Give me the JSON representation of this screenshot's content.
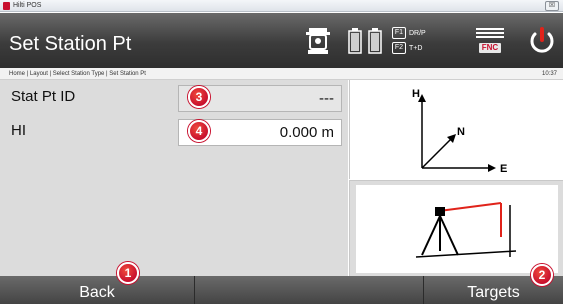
{
  "window": {
    "title": "Hilti POS",
    "close_label": "☒"
  },
  "header": {
    "title": "Set Station Pt",
    "icons": [
      "instrument-icon",
      "battery-icon",
      "fnc-icon",
      "power-icon"
    ],
    "func_keys": [
      {
        "key": "F1",
        "label": "DR/P"
      },
      {
        "key": "F2",
        "label": "T+D"
      }
    ],
    "fnc_label": "FNC"
  },
  "breadcrumb": "Home | Layout | Select Station Type | Set Station Pt",
  "clock": "10:37",
  "fields": {
    "stat_pt_id": {
      "label": "Stat Pt ID",
      "value": "---"
    },
    "hi": {
      "label": "HI",
      "value": "0.000 m"
    }
  },
  "diagram": {
    "axis_h": "H",
    "axis_n": "N",
    "axis_e": "E"
  },
  "footer": {
    "back_label": "Back",
    "targets_label": "Targets"
  },
  "callouts": {
    "c1": "1",
    "c2": "2",
    "c3": "3",
    "c4": "4"
  },
  "colors": {
    "accent": "#c8102e",
    "header_dark": "#3c3c3c",
    "panel": "#dcdcdc"
  }
}
